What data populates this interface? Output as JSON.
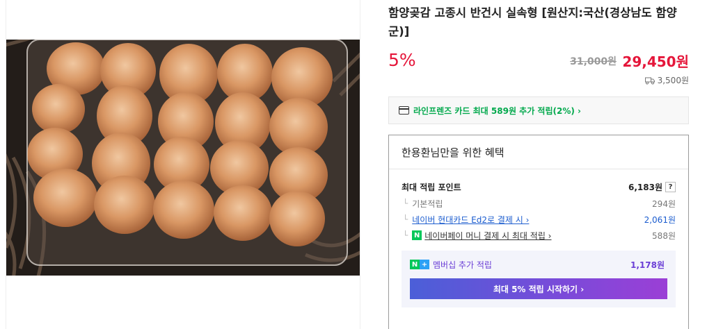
{
  "product": {
    "title": "함양곶감 고종시 반건시 실속형 [원산지:국산(경상남도 함양군)]",
    "discount": "5%",
    "original_price": "31,000원",
    "sale_price": "29,450원",
    "shipping": "3,500원"
  },
  "card_promo": {
    "text": "라인프렌즈 카드 최대 589원 추가 적립(2%) ›"
  },
  "benefit": {
    "heading": "한용환님만을 위한 혜택",
    "max_points_label": "최대 적립 포인트",
    "max_points_value": "6,183원",
    "help": "?",
    "rows": [
      {
        "indent": "└",
        "label": "기본적립",
        "value": "294원"
      },
      {
        "indent": "└",
        "label": "네이버 현대카드 Ed2로 결제 시 ›",
        "value": "2,061원"
      },
      {
        "indent": "└",
        "badge": "N",
        "label": "네이버페이 머니 결제 시 최대 적립 ›",
        "value": "588원"
      }
    ],
    "membership": {
      "badge_n": "N",
      "badge_plus": "+",
      "label": "멤버십 추가 적립",
      "value": "1,178원",
      "button": "최대 5% 적립 시작하기 ›"
    }
  },
  "colors": {
    "accent_red": "#e5163a",
    "naver_green": "#03c75a",
    "member_purple": "#6b3fd6"
  },
  "icons": [
    "product-photo",
    "truck-icon",
    "credit-card-icon",
    "naverpay-icon",
    "naver-plus-icon"
  ]
}
